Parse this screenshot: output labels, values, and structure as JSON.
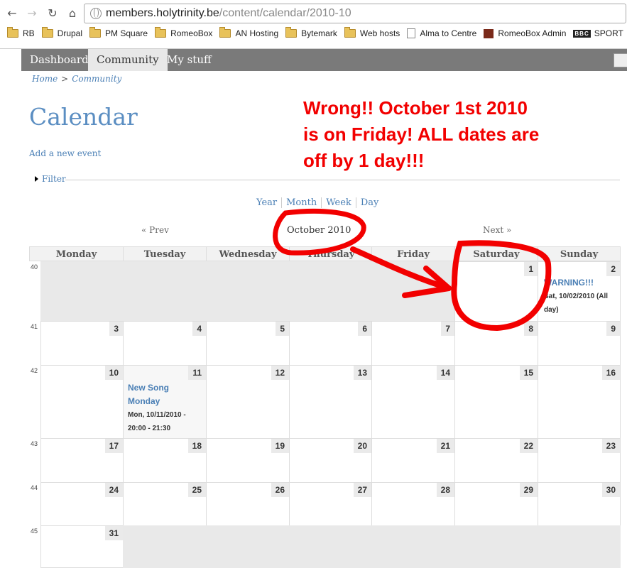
{
  "browser": {
    "url_host": "members.holytrinity.be",
    "url_path": "/content/calendar/2010-10",
    "bookmarks": [
      "RB",
      "Drupal",
      "PM Square",
      "RomeoBox",
      "AN Hosting",
      "Bytemark",
      "Web hosts",
      "Alma to Centre",
      "RomeoBox Admin",
      "SPORT"
    ]
  },
  "nav": {
    "tabs": [
      "Dashboard",
      "Community",
      "My stuff"
    ]
  },
  "breadcrumb": {
    "home": "Home",
    "sep": ">",
    "community": "Community"
  },
  "page": {
    "title": "Calendar",
    "add_link": "Add a new event",
    "filter": "Filter"
  },
  "views": [
    "Year",
    "Month",
    "Week",
    "Day"
  ],
  "pager": {
    "prev": "« Prev",
    "month": "October 2010",
    "next": "Next »"
  },
  "annotation": [
    "Wrong!!  October 1st 2010",
    "is on Friday!  ALL dates are",
    "off by 1 day!!!"
  ],
  "calendar": {
    "day_headers": [
      "Monday",
      "Tuesday",
      "Wednesday",
      "Thursday",
      "Friday",
      "Saturday",
      "Sunday"
    ],
    "weeks": [
      {
        "num": "40",
        "days": [
          "",
          "",
          "",
          "",
          "",
          "1",
          "2"
        ]
      },
      {
        "num": "41",
        "days": [
          "3",
          "4",
          "5",
          "6",
          "7",
          "8",
          "9"
        ]
      },
      {
        "num": "42",
        "days": [
          "10",
          "11",
          "12",
          "13",
          "14",
          "15",
          "16"
        ]
      },
      {
        "num": "43",
        "days": [
          "17",
          "18",
          "19",
          "20",
          "21",
          "22",
          "23"
        ]
      },
      {
        "num": "44",
        "days": [
          "24",
          "25",
          "26",
          "27",
          "28",
          "29",
          "30"
        ]
      },
      {
        "num": "45",
        "days": [
          "31",
          "",
          "",
          "",
          "",
          "",
          ""
        ]
      }
    ],
    "events": {
      "warning": {
        "title": "WARNING!!!",
        "date": "Sat, 10/02/2010 (All day)"
      },
      "song": {
        "title_1": "New Song",
        "title_2": "Monday",
        "date_1": "Mon, 10/11/2010 -",
        "date_2": "20:00 - 21:30"
      }
    }
  },
  "colors": {
    "annotation": "#f20000",
    "link": "#4a7fb5",
    "nav_bg": "#7a7a7a"
  }
}
